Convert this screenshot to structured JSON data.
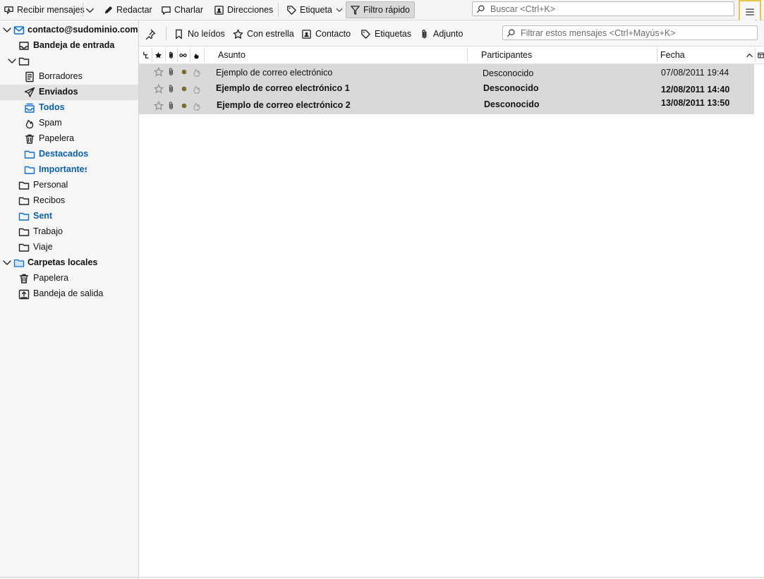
{
  "toolbar": {
    "get_messages": "Recibir mensajes",
    "write": "Redactar",
    "chat": "Charlar",
    "address_book": "Direcciones",
    "tag": "Etiqueta",
    "quick_filter": "Filtro rápido",
    "search_placeholder": "Buscar <Ctrl+K>"
  },
  "folders": {
    "account": "contacto@sudominio.com",
    "inbox": "Bandeja de entrada",
    "unnamed": "",
    "drafts": "Borradores",
    "sent": "Enviados",
    "all": "Todos",
    "spam": "Spam",
    "trash": "Papelera",
    "starred": "Destacados",
    "important": "Importantes",
    "personal": "Personal",
    "receipts": "Recibos",
    "sent_en": "Sent",
    "work": "Trabajo",
    "travel": "Viaje",
    "local_folders": "Carpetas locales",
    "local_trash": "Papelera",
    "outbox": "Bandeja de salida"
  },
  "filterbar": {
    "unread": "No leídos",
    "starred": "Con estrella",
    "contact": "Contacto",
    "tags": "Etiquetas",
    "attachment": "Adjunto",
    "filter_placeholder": "Filtrar estos mensajes <Ctrl+Mayús+K>"
  },
  "columns": {
    "subject": "Asunto",
    "participants": "Participantes",
    "date": "Fecha"
  },
  "messages": [
    {
      "subject": "Ejemplo de correo electrónico",
      "participants": "Desconocido",
      "date": "07/08/2011  19:44"
    },
    {
      "subject": "Ejemplo de correo electrónico 1",
      "participants": "Desconocido",
      "date": "12/08/2011  14:40"
    },
    {
      "subject": "Ejemplo de correo electrónico 2",
      "participants": "Desconocido",
      "date": "13/08/2011  13:50"
    }
  ],
  "colors": {
    "accent": "#0b6fd0",
    "row_selected": "#d9d9d9",
    "menu_highlight": "#e8c54b",
    "read_dot": "#7a6a2e"
  }
}
